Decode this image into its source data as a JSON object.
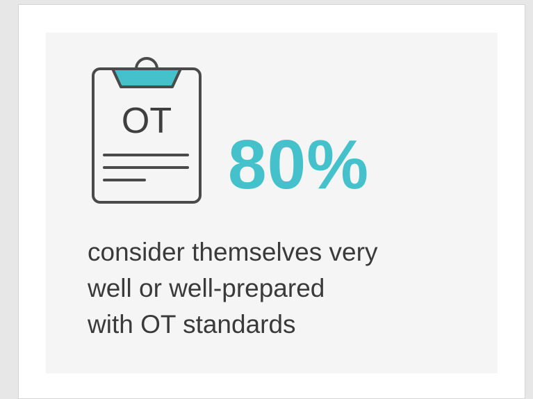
{
  "icon": {
    "name": "clipboard-icon",
    "label": "OT"
  },
  "stat": {
    "value": "80%"
  },
  "caption": {
    "lines": [
      "consider themselves very",
      "well or well-prepared",
      "with OT standards"
    ]
  },
  "colors": {
    "accent": "#45c1cc",
    "text": "#3a3a3a",
    "card_background": "#f5f5f5",
    "icon_stroke": "#4a4a4a"
  }
}
